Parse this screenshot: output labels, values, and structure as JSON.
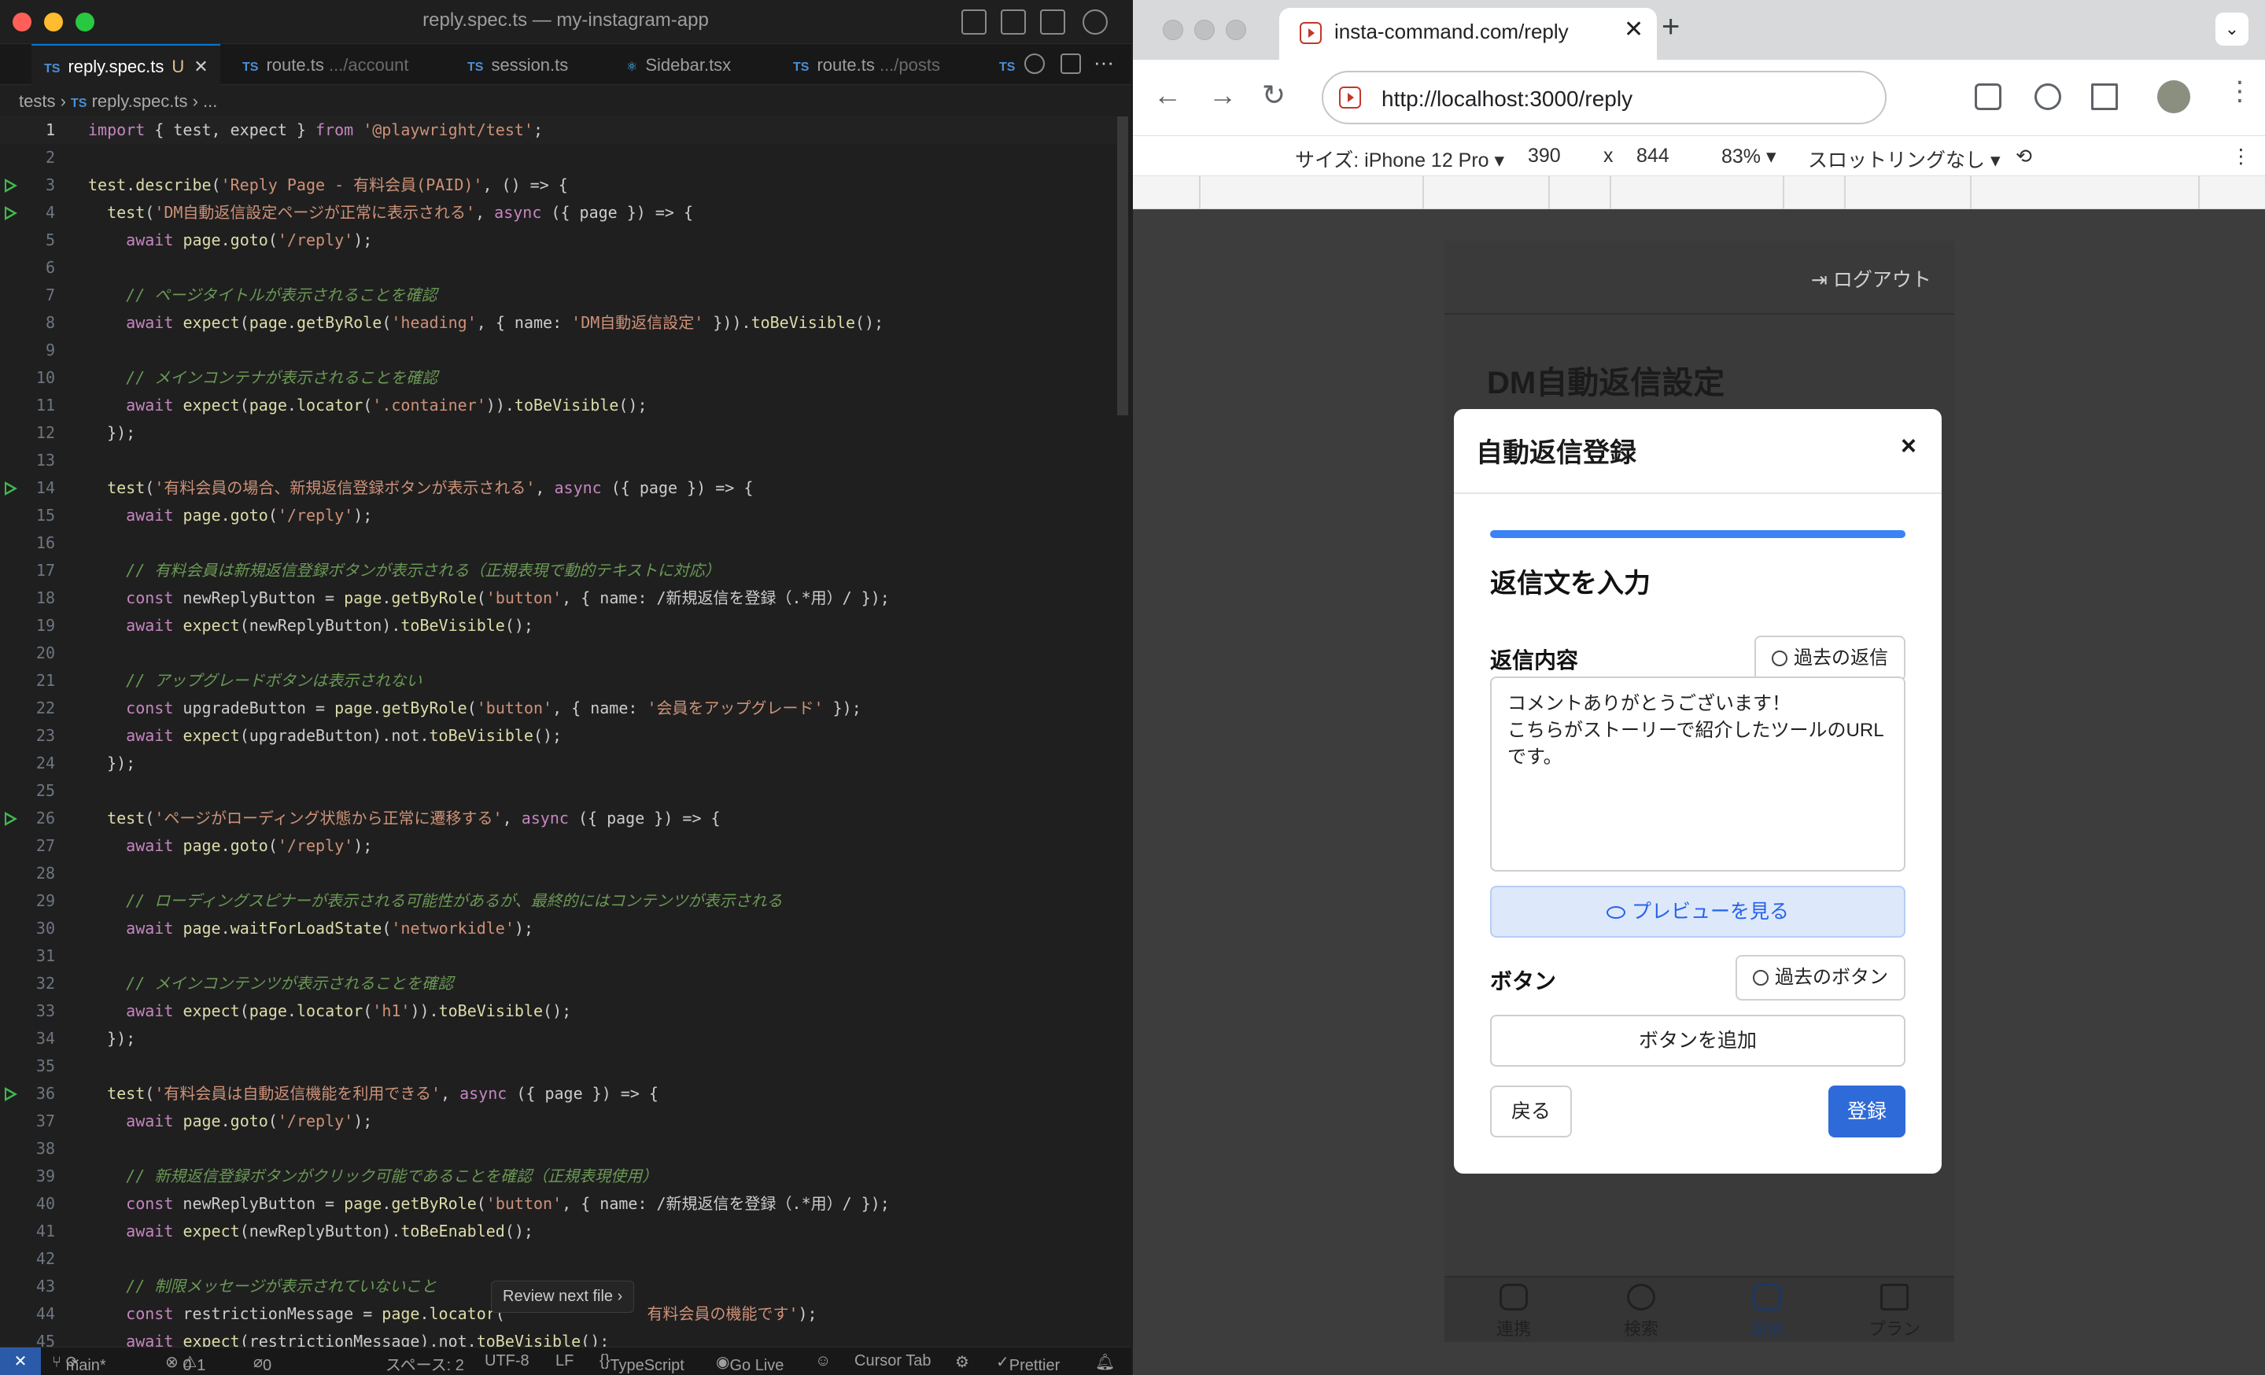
{
  "editor": {
    "window_title": "reply.spec.ts — my-instagram-app",
    "tabs": [
      {
        "name": "reply.spec.ts",
        "suffix": "U",
        "active": true
      },
      {
        "name": "route.ts",
        "dim": ".../account"
      },
      {
        "name": "session.ts",
        "dim": ""
      },
      {
        "name": "Sidebar.tsx",
        "dim": ""
      },
      {
        "name": "route.ts",
        "dim": ".../posts"
      }
    ],
    "tab_lang": "TS",
    "breadcrumb": {
      "folder": "tests",
      "file": "reply.spec.ts",
      "more": "..."
    },
    "review_next": "Review next file",
    "code_lines": [
      {
        "n": "1",
        "text": "import { test, expect } from '@playwright/test';"
      },
      {
        "n": "2",
        "text": ""
      },
      {
        "n": "3",
        "text": "test.describe('Reply Page - 有料会員(PAID)', () => {"
      },
      {
        "n": "4",
        "text": "  test('DM自動返信設定ページが正常に表示される', async ({ page }) => {"
      },
      {
        "n": "5",
        "text": "    await page.goto('/reply');"
      },
      {
        "n": "6",
        "text": ""
      },
      {
        "n": "7",
        "text": "    // ページタイトルが表示されることを確認"
      },
      {
        "n": "8",
        "text": "    await expect(page.getByRole('heading', { name: 'DM自動返信設定' })).toBeVisible();"
      },
      {
        "n": "9",
        "text": ""
      },
      {
        "n": "10",
        "text": "    // メインコンテナが表示されることを確認"
      },
      {
        "n": "11",
        "text": "    await expect(page.locator('.container')).toBeVisible();"
      },
      {
        "n": "12",
        "text": "  });"
      },
      {
        "n": "13",
        "text": ""
      },
      {
        "n": "14",
        "text": "  test('有料会員の場合、新規返信登録ボタンが表示される', async ({ page }) => {"
      },
      {
        "n": "15",
        "text": "    await page.goto('/reply');"
      },
      {
        "n": "16",
        "text": ""
      },
      {
        "n": "17",
        "text": "    // 有料会員は新規返信登録ボタンが表示される（正規表現で動的テキストに対応）"
      },
      {
        "n": "18",
        "text": "    const newReplyButton = page.getByRole('button', { name: /新規返信を登録（.*用）/ });"
      },
      {
        "n": "19",
        "text": "    await expect(newReplyButton).toBeVisible();"
      },
      {
        "n": "20",
        "text": ""
      },
      {
        "n": "21",
        "text": "    // アップグレードボタンは表示されない"
      },
      {
        "n": "22",
        "text": "    const upgradeButton = page.getByRole('button', { name: '会員をアップグレード' });"
      },
      {
        "n": "23",
        "text": "    await expect(upgradeButton).not.toBeVisible();"
      },
      {
        "n": "24",
        "text": "  });"
      },
      {
        "n": "25",
        "text": ""
      },
      {
        "n": "26",
        "text": "  test('ページがローディング状態から正常に遷移する', async ({ page }) => {"
      },
      {
        "n": "27",
        "text": "    await page.goto('/reply');"
      },
      {
        "n": "28",
        "text": ""
      },
      {
        "n": "29",
        "text": "    // ローディングスピナーが表示される可能性があるが、最終的にはコンテンツが表示される"
      },
      {
        "n": "30",
        "text": "    await page.waitForLoadState('networkidle');"
      },
      {
        "n": "31",
        "text": ""
      },
      {
        "n": "32",
        "text": "    // メインコンテンツが表示されることを確認"
      },
      {
        "n": "33",
        "text": "    await expect(page.locator('h1')).toBeVisible();"
      },
      {
        "n": "34",
        "text": "  });"
      },
      {
        "n": "35",
        "text": ""
      },
      {
        "n": "36",
        "text": "  test('有料会員は自動返信機能を利用できる', async ({ page }) => {"
      },
      {
        "n": "37",
        "text": "    await page.goto('/reply');"
      },
      {
        "n": "38",
        "text": ""
      },
      {
        "n": "39",
        "text": "    // 新規返信登録ボタンがクリック可能であることを確認（正規表現使用）"
      },
      {
        "n": "40",
        "text": "    const newReplyButton = page.getByRole('button', { name: /新規返信を登録（.*用）/ });"
      },
      {
        "n": "41",
        "text": "    await expect(newReplyButton).toBeEnabled();"
      },
      {
        "n": "42",
        "text": ""
      },
      {
        "n": "43",
        "text": "    // 制限メッセージが表示されていないこと"
      },
      {
        "n": "44",
        "text": "    const restrictionMessage = page.locator('              有料会員の機能です');"
      },
      {
        "n": "45",
        "text": "    await expect(restrictionMessage).not.toBeVisible();"
      }
    ],
    "run_lines": [
      "3",
      "4",
      "14",
      "26",
      "36"
    ],
    "status": {
      "branch": "main*",
      "errors": "0",
      "warnings": "1",
      "ports": "0",
      "spaces": "スペース: 2",
      "encoding": "UTF-8",
      "eol": "LF",
      "language": "TypeScript",
      "golive": "Go Live",
      "cursortab": "Cursor Tab",
      "prettier": "Prettier"
    }
  },
  "browser": {
    "tab_title": "insta-command.com/reply",
    "url": "http://localhost:3000/reply",
    "devtools": {
      "size_label": "サイズ: iPhone 12 Pro",
      "width": "390",
      "times": "x",
      "height": "844",
      "zoom": "83%",
      "throttle": "スロットリングなし"
    },
    "app": {
      "logout": "ログアウト",
      "heading": "DM自動返信設定",
      "bottom_nav": [
        "連携",
        "検索",
        "返信",
        "プラン"
      ],
      "bottom_nav_active": "返信"
    },
    "modal": {
      "title": "自動返信登録",
      "close": "×",
      "progress": 1.0,
      "step_title": "返信文を入力",
      "reply_label": "返信内容",
      "past_reply_button": "過去の返信",
      "reply_text": "コメントありがとうございます！\nこちらがストーリーで紹介したツールのURLです。",
      "preview_button": "プレビューを見る",
      "button_label": "ボタン",
      "past_button_button": "過去のボタン",
      "add_button": "ボタンを追加",
      "back": "戻る",
      "submit": "登録"
    },
    "colors": {
      "accent": "#2f6bd8",
      "progress": "#3b82f6",
      "preview_bg": "#dde8fb"
    }
  }
}
